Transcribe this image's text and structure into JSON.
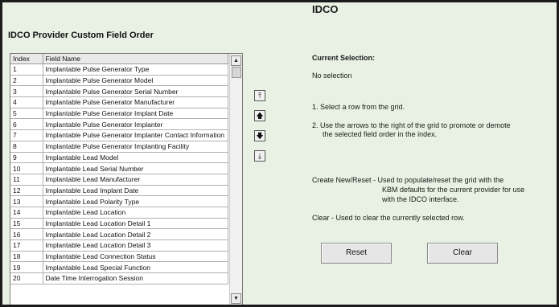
{
  "app_title": "IDCO",
  "section_title": "IDCO Provider Custom Field Order",
  "grid": {
    "columns": [
      "Index",
      "Field Name"
    ],
    "rows": [
      {
        "index": "1",
        "name": "Implantable Pulse Generator Type"
      },
      {
        "index": "2",
        "name": "Implantable Pulse Generator Model"
      },
      {
        "index": "3",
        "name": "Implantable Pulse Generator Serial Number"
      },
      {
        "index": "4",
        "name": "Implantable Pulse Generator Manufacturer"
      },
      {
        "index": "5",
        "name": "Implantable Pulse Generator Implant Date"
      },
      {
        "index": "6",
        "name": "Implantable Pulse Generator Implanter"
      },
      {
        "index": "7",
        "name": "Implantable Pulse Generator Implanter Contact Information"
      },
      {
        "index": "8",
        "name": "Implantable Pulse Generator Implanting Facility"
      },
      {
        "index": "9",
        "name": "Implantable Lead Model"
      },
      {
        "index": "10",
        "name": "Implantable Lead Serial Number"
      },
      {
        "index": "11",
        "name": "Implantable Lead Manufacturer"
      },
      {
        "index": "12",
        "name": "Implantable Lead Implant Date"
      },
      {
        "index": "13",
        "name": "Implantable Lead Polarity Type"
      },
      {
        "index": "14",
        "name": "Implantable Lead Location"
      },
      {
        "index": "15",
        "name": "Implantable Lead Location Detail 1"
      },
      {
        "index": "16",
        "name": "Implantable Lead Location Detail 2"
      },
      {
        "index": "17",
        "name": "Implantable Lead Location Detail 3"
      },
      {
        "index": "18",
        "name": "Implantable Lead Connection Status"
      },
      {
        "index": "19",
        "name": "Implantable Lead Special Function"
      },
      {
        "index": "20",
        "name": "Date Time Interrogation Session"
      }
    ]
  },
  "move_buttons": {
    "top_icon": "move-to-top-icon",
    "up_icon": "move-up-icon",
    "down_icon": "move-down-icon",
    "bottom_icon": "move-to-bottom-icon"
  },
  "info": {
    "current_selection_label": "Current Selection:",
    "current_selection_value": "No selection",
    "step1": "1. Select a row from the grid.",
    "step2_line1": "2. Use the arrows to the right of the grid to promote or demote",
    "step2_line2": "the selected field order in the index.",
    "create_line1": "Create New/Reset - Used to populate/reset the grid with the",
    "create_line2": "KBM defaults for the current provider for use",
    "create_line3": "with the IDCO interface.",
    "clear_text": "Clear - Used to clear the currently selected row."
  },
  "buttons": {
    "reset": "Reset",
    "clear": "Clear"
  },
  "colors": {
    "panel_background": "#e8f1e3",
    "frame_border": "#1b1b1b"
  }
}
